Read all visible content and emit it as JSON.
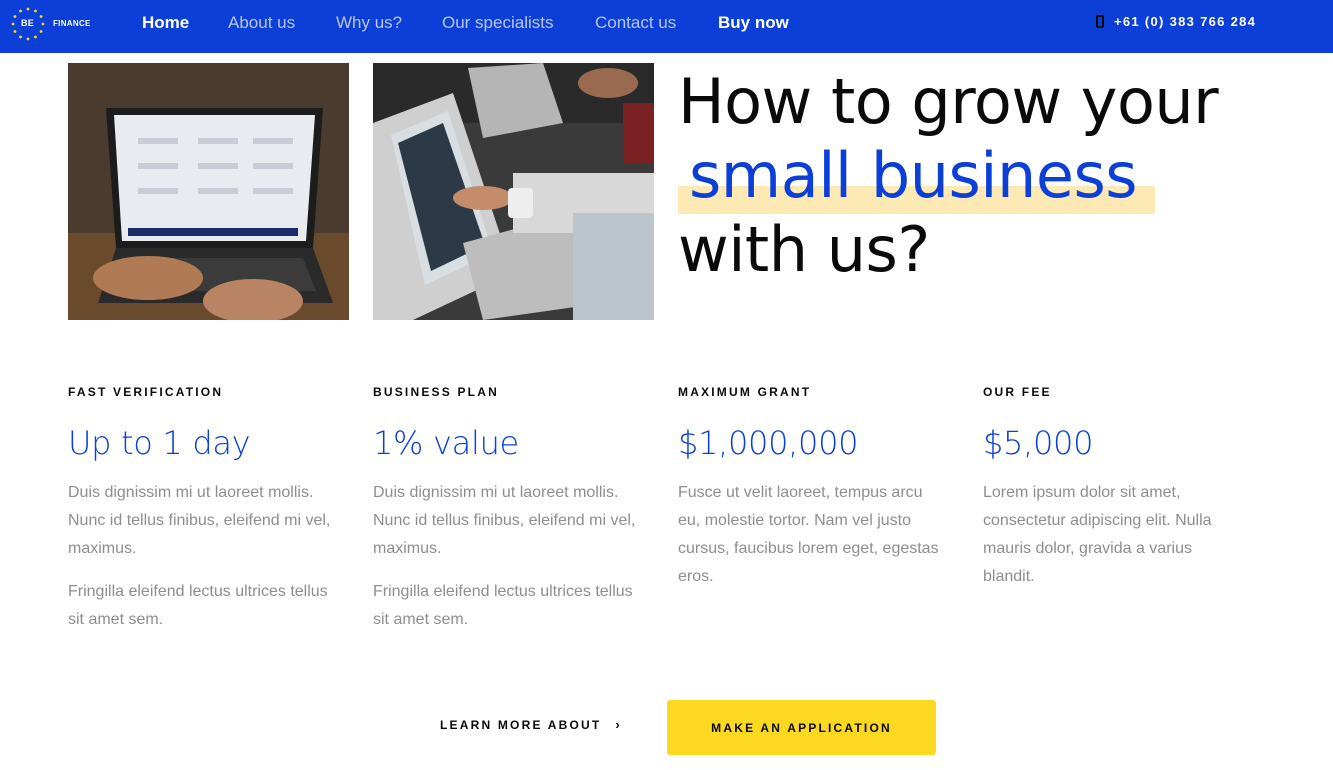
{
  "header": {
    "logo": {
      "be": "BE",
      "finance": "FINANCE"
    },
    "nav": [
      {
        "label": "Home",
        "active": true
      },
      {
        "label": "About us"
      },
      {
        "label": "Why us?"
      },
      {
        "label": "Our specialists"
      },
      {
        "label": "Contact us"
      },
      {
        "label": "Buy now"
      }
    ],
    "phone": {
      "icon": "phone-icon",
      "text": "+61 (0) 383 766 284"
    }
  },
  "hero": {
    "line1": "How to grow your",
    "line2": "small business",
    "line3": "with us?",
    "images": [
      {
        "alt": "hands typing on laptop with dashboard"
      },
      {
        "alt": "person pointing at laptop screen"
      }
    ]
  },
  "features": [
    {
      "label": "FAST VERIFICATION",
      "value": "Up to 1 day",
      "paragraphs": [
        "Duis dignissim mi ut laoreet mollis. Nunc id tellus finibus, eleifend mi vel, maximus.",
        "Fringilla eleifend lectus ultrices tellus sit amet sem."
      ]
    },
    {
      "label": "BUSINESS PLAN",
      "value": "1% value",
      "paragraphs": [
        "Duis dignissim mi ut laoreet mollis. Nunc id tellus finibus, eleifend mi vel, maximus.",
        "Fringilla eleifend lectus ultrices tellus sit amet sem."
      ]
    },
    {
      "label": "MAXIMUM GRANT",
      "value": "$1,000,000",
      "paragraphs": [
        "Fusce ut velit laoreet, tempus arcu eu, molestie tortor. Nam vel justo cursus, faucibus lorem eget, egestas eros."
      ]
    },
    {
      "label": "OUR FEE",
      "value": "$5,000",
      "paragraphs": [
        "Lorem ipsum dolor sit amet, consectetur adipiscing elit. Nulla mauris dolor, gravida a varius blandit."
      ]
    }
  ],
  "cta": {
    "learn_more": "LEARN MORE ABOUT",
    "learn_more_icon": "chevron-right-icon",
    "apply": "MAKE AN APPLICATION"
  },
  "colors": {
    "brand_blue": "#0b3fd8",
    "highlight": "#fde9b3",
    "button_yellow": "#fdd820",
    "muted_text": "#8e8e8e"
  }
}
